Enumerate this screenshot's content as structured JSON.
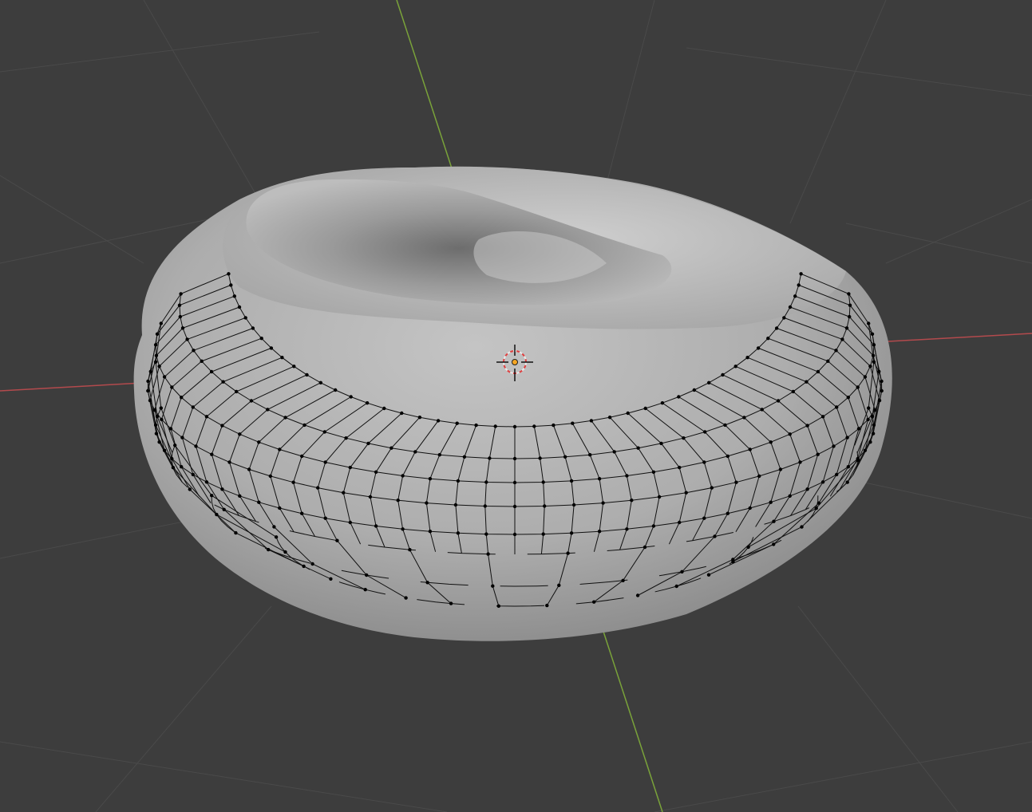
{
  "app": "3D viewport",
  "viewport": {
    "mode": "edit-mode",
    "shading": "solid",
    "background_color": "#3d3d3d",
    "grid_color": "#4a4a4a",
    "x_axis_color": "#b34a4d",
    "y_axis_color": "#7aa33a"
  },
  "object": {
    "shape": "torus",
    "surface_color": "#a6a6a6",
    "wire_color": "#111111",
    "vertex_color": "#000000"
  },
  "cursor": {
    "icon": "3d-cursor-icon",
    "ring_color_a": "#e8e8e8",
    "ring_color_b": "#e04040"
  },
  "origin": {
    "icon": "object-origin-icon",
    "color": "#f5a623"
  }
}
